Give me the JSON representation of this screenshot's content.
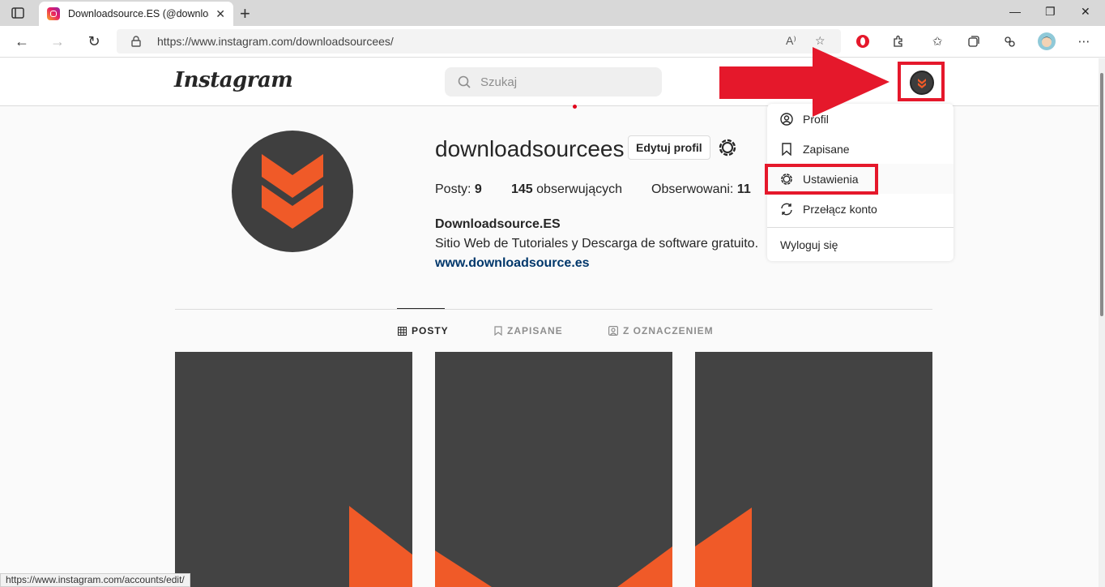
{
  "browser": {
    "tab_title": "Downloadsource.ES (@downloadsourcees)",
    "tab_close": "✕",
    "new_tab": "+",
    "url": "https://www.instagram.com/downloadsourcees/",
    "read_aloud": "A⁾",
    "status_url": "https://www.instagram.com/accounts/edit/"
  },
  "instagram": {
    "logo": "Instagram",
    "search_placeholder": "Szukaj"
  },
  "profile": {
    "username": "downloadsourcees",
    "edit_button": "Edytuj profil",
    "posts_label": "Posty:",
    "posts_count": "9",
    "followers_count": "145",
    "followers_label": "obserwujących",
    "following_label": "Obserwowani:",
    "following_count": "11",
    "full_name": "Downloadsource.ES",
    "bio": "Sitio Web de Tutoriales y Descarga de software gratuito.",
    "website": "www.downloadsource.es"
  },
  "tabs": {
    "posts": "POSTY",
    "saved": "ZAPISANE",
    "tagged": "Z OZNACZENIEM"
  },
  "dropdown": {
    "items": [
      {
        "label": "Profil",
        "icon": "profile-icon"
      },
      {
        "label": "Zapisane",
        "icon": "bookmark-icon"
      },
      {
        "label": "Ustawienia",
        "icon": "settings-icon"
      },
      {
        "label": "Przełącz konto",
        "icon": "switch-icon"
      }
    ],
    "logout": "Wyloguj się"
  },
  "colors": {
    "accent_red": "#e5182b",
    "brand_orange": "#f05a28",
    "avatar_bg": "#3f3f3f"
  }
}
